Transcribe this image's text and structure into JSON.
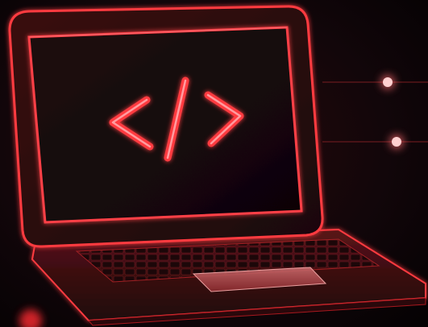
{
  "scene": {
    "subject": "laptop-with-code-symbol",
    "colors": {
      "background": "#0a0405",
      "neon": "#ff3a40",
      "neon_soft": "#b3161c",
      "body_dark": "#1a0708",
      "screen": "#16090a"
    },
    "icons": {
      "code_symbol": "code-brackets-icon",
      "connector_dots": "connector-dot-icon"
    }
  }
}
